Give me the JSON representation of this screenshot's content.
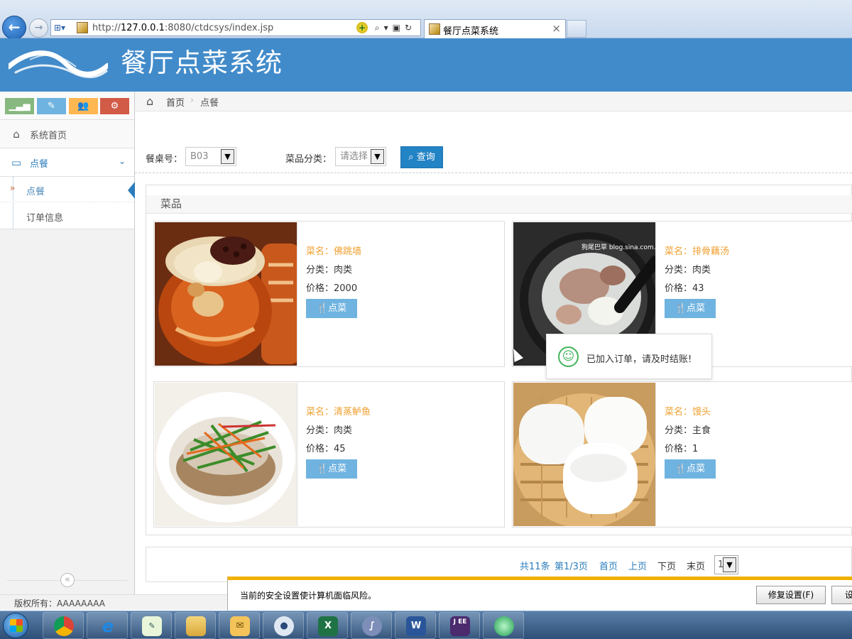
{
  "browser": {
    "address_prefix": "http://",
    "address_host": "127.0.0.1",
    "address_rest": ":8080/ctdcsys/index.jsp",
    "tab_title": "餐厅点菜系统",
    "tab_close": "×"
  },
  "header": {
    "title": "餐厅点菜系统"
  },
  "sidebar": {
    "items": [
      {
        "label": "系统首页",
        "icon": "home-icon"
      },
      {
        "label": "点餐",
        "icon": "credit-card-icon"
      }
    ],
    "submenu": [
      {
        "label": "点餐",
        "active": true
      },
      {
        "label": "订单信息",
        "active": false
      }
    ],
    "shortcut_colors": [
      "#87b87f",
      "#6fb3e0",
      "#ffb752",
      "#d15b47"
    ],
    "collapse_symbol": "«"
  },
  "breadcrumb": {
    "home": "首页",
    "separator": "›",
    "current": "点餐"
  },
  "filters": {
    "table_label": "餐桌号：",
    "table_value": "B03",
    "category_label": "菜品分类：",
    "category_value": "请选择",
    "query_label": "查询"
  },
  "dishes": {
    "panel_title": "菜品",
    "order_label": "点菜",
    "items": [
      {
        "name": "菜名：佛跳墙",
        "category": "分类：肉类",
        "price": "价格：2000"
      },
      {
        "name": "菜名：排骨藕汤",
        "category": "分类：肉类",
        "price": "价格：43"
      },
      {
        "name": "菜名：清蒸鲈鱼",
        "category": "分类：肉类",
        "price": "价格：45"
      },
      {
        "name": "菜名：馒头",
        "category": "分类：主食",
        "price": "价格：1"
      }
    ],
    "watermark": "狗尾巴草 blog.sina.com.cn"
  },
  "pagination": {
    "total": "共11条",
    "page_info": "第1/3页",
    "first": "首页",
    "prev": "上页",
    "next": "下页",
    "last": "末页",
    "page_select": "1"
  },
  "toast": {
    "message": "已加入订单，请及时结账!"
  },
  "footer": {
    "copyright": "版权所有：AAAAAAAA"
  },
  "security_bar": {
    "message": "当前的安全设置使计算机面临风险。",
    "fix_button": "修复设置(F)",
    "more_button": "设"
  },
  "taskbar": {
    "apps": [
      "chrome-icon",
      "ie-icon",
      "notepad-icon",
      "explorer-icon",
      "mail-icon",
      "avatar-icon",
      "excel-icon",
      "eclipse-icon",
      "word-icon",
      "javaee-icon",
      "orb-icon"
    ]
  }
}
